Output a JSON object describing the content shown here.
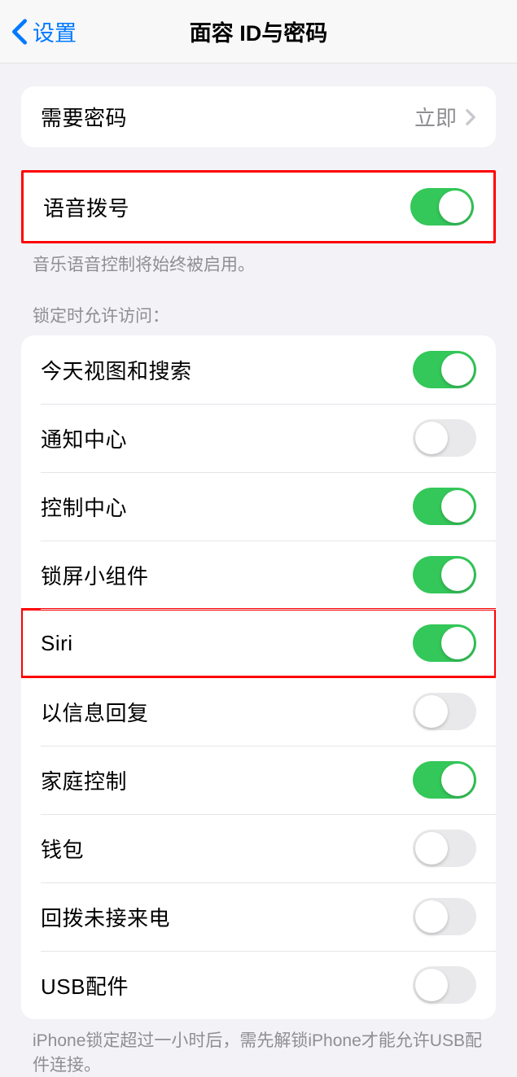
{
  "nav": {
    "back_label": "设置",
    "title": "面容 ID与密码"
  },
  "passcode": {
    "require_label": "需要密码",
    "require_value": "立即"
  },
  "voice_dial": {
    "label": "语音拨号",
    "footer": "音乐语音控制将始终被启用。",
    "on": true
  },
  "lock_access": {
    "header": "锁定时允许访问：",
    "items": [
      {
        "label": "今天视图和搜索",
        "on": true
      },
      {
        "label": "通知中心",
        "on": false
      },
      {
        "label": "控制中心",
        "on": true
      },
      {
        "label": "锁屏小组件",
        "on": true
      },
      {
        "label": "Siri",
        "on": true,
        "highlighted": true
      },
      {
        "label": "以信息回复",
        "on": false
      },
      {
        "label": "家庭控制",
        "on": true
      },
      {
        "label": "钱包",
        "on": false
      },
      {
        "label": "回拨未接来电",
        "on": false
      },
      {
        "label": "USB配件",
        "on": false
      }
    ],
    "footer": "iPhone锁定超过一小时后，需先解锁iPhone才能允许USB配件连接。"
  }
}
